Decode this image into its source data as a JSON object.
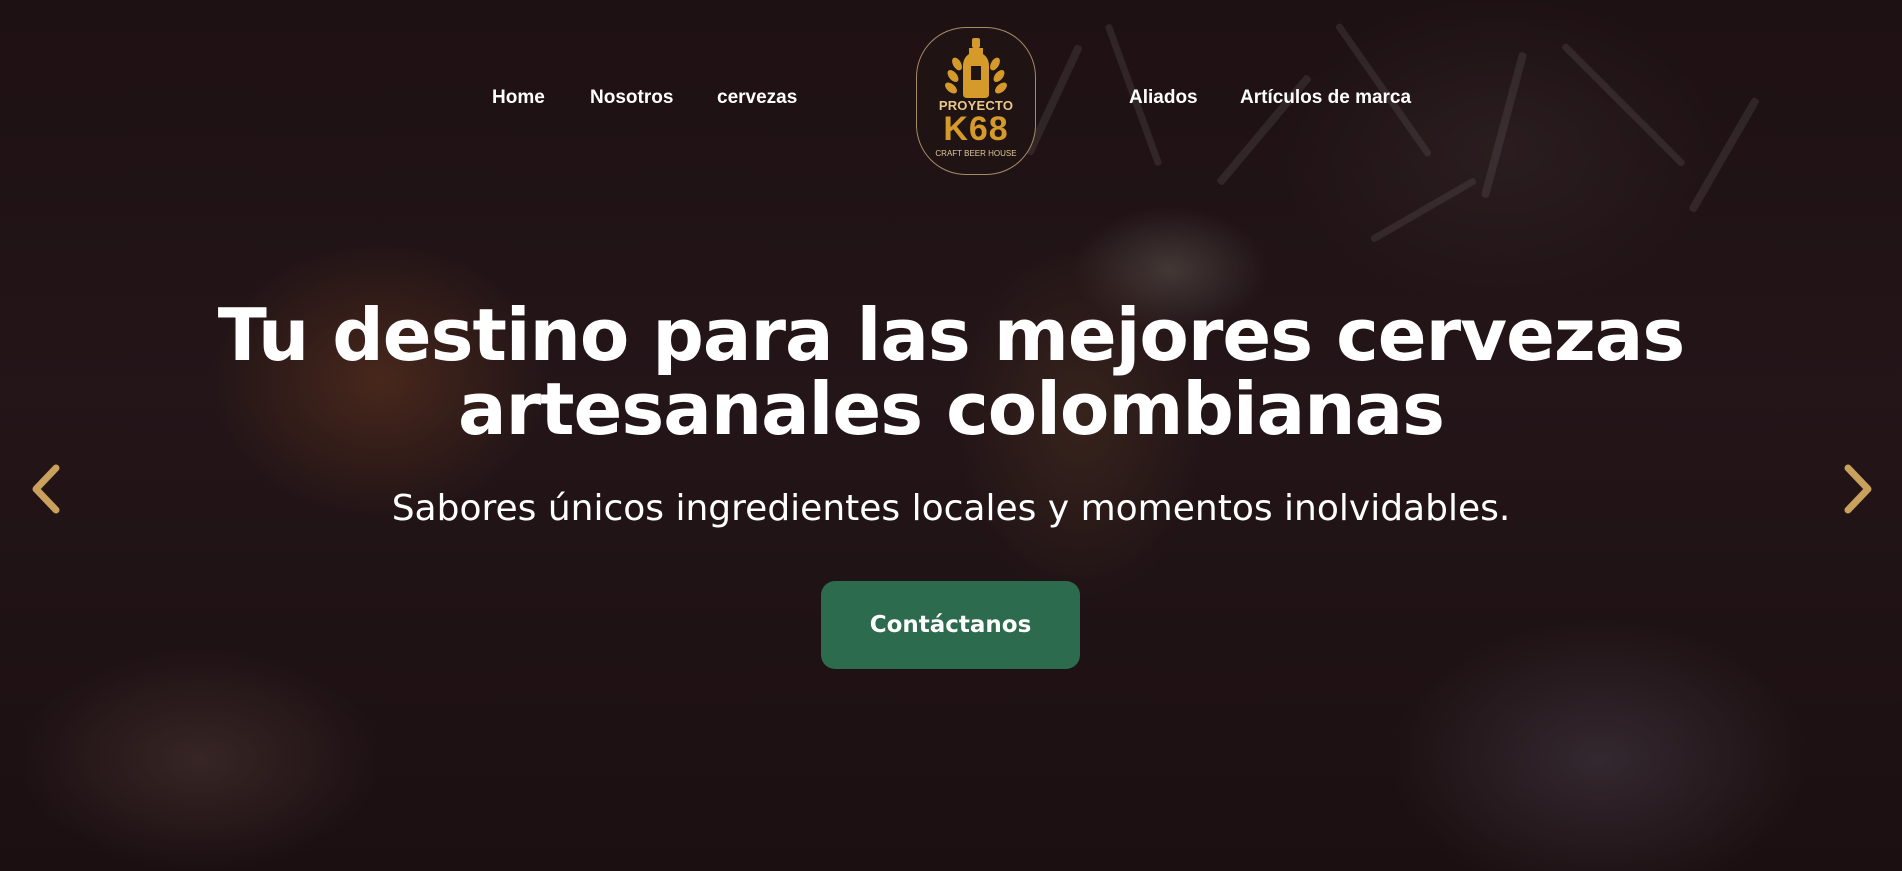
{
  "nav": {
    "left_links": [
      "Home",
      "Nosotros",
      "cervezas"
    ],
    "right_links": [
      "Aliados",
      "Artículos de marca"
    ]
  },
  "logo": {
    "line1": "PROYECTO",
    "line2": "K68",
    "line3": "CRAFT BEER HOUSE"
  },
  "hero": {
    "title": "Tu destino para las mejores cervezas artesanales colombianas",
    "subtitle": "Sabores únicos ingredientes locales y momentos inolvidables.",
    "cta_label": "Contáctanos"
  },
  "icons": {
    "prev": "chevron-left-icon",
    "next": "chevron-right-icon"
  },
  "colors": {
    "accent_gold": "#c9a15c",
    "cta_green": "#2c6b4d"
  }
}
